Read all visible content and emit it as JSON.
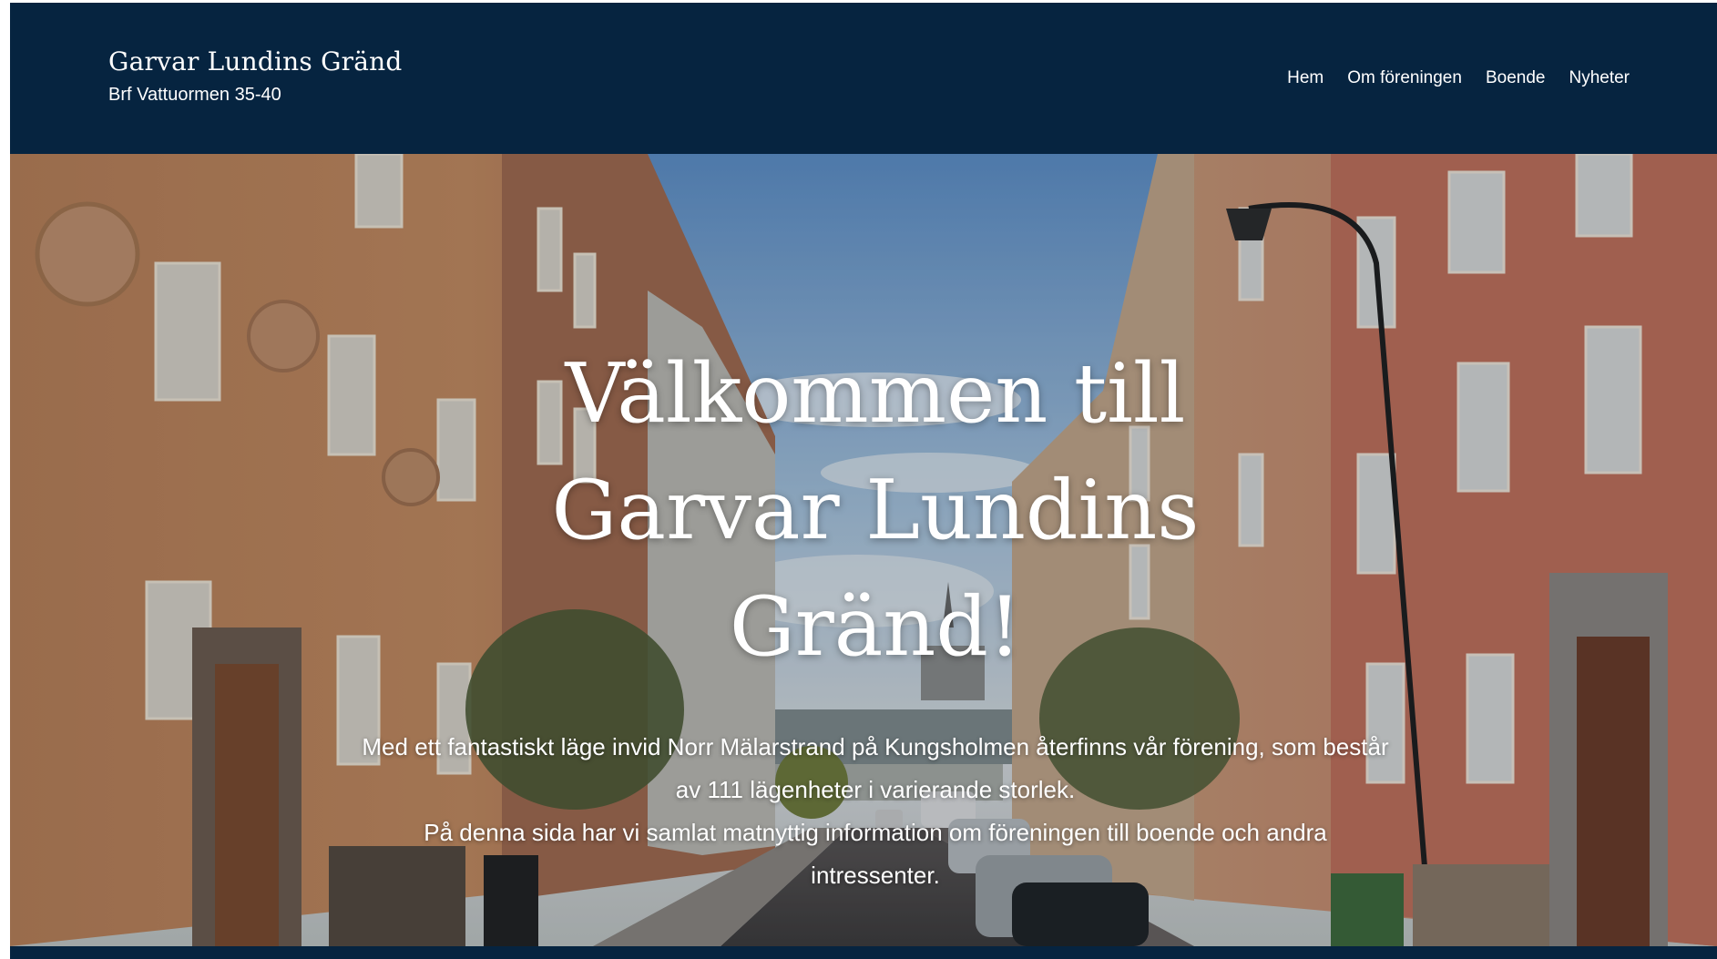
{
  "header": {
    "site_title": "Garvar Lundins Gränd",
    "site_subtitle": "Brf Vattuormen 35-40",
    "nav": [
      {
        "label": "Hem"
      },
      {
        "label": "Om föreningen"
      },
      {
        "label": "Boende"
      },
      {
        "label": "Nyheter"
      }
    ]
  },
  "hero": {
    "title": "Välkommen till Garvar Lundins Gränd!",
    "paragraph_1": "Med ett fantastiskt läge invid Norr Mälarstrand på Kungsholmen återfinns vår förening, som består av 111 lägenheter i varierande storlek.",
    "paragraph_2": "På denna sida har vi samlat matnyttig information om föreningen till boende och andra intressenter."
  },
  "colors": {
    "header_bg": "#062440",
    "text": "#ffffff"
  }
}
